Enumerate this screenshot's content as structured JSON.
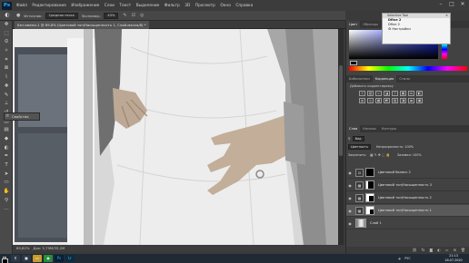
{
  "menu": {
    "items": [
      "Файл",
      "Редактирование",
      "Изображение",
      "Слои",
      "Текст",
      "Выделение",
      "Фильтр",
      "3D",
      "Просмотр",
      "Окно",
      "Справка"
    ]
  },
  "options": {
    "source_label": "Источник:",
    "sample_select": "Средняя точка",
    "exposure_label": "Экспонир.:",
    "exposure_value": "43%"
  },
  "document": {
    "tab_title": "Без имени-1 @ 89,8% (Цветовой тон/Насыщенность 1, Слой-маска/8) *",
    "zoom": "89,82%",
    "doc_info": "Док: 5,79М/35,2М"
  },
  "properties_float": {
    "label": "Свойства"
  },
  "panels": {
    "color_tabs": [
      "Цвет",
      "Образцы"
    ],
    "adj_tabs": [
      "Библиотеки",
      "Коррекция",
      "Стили"
    ],
    "adj_title": "Добавить корректировку",
    "layer_tabs": [
      "Слои",
      "Каналы",
      "Контуры"
    ],
    "filter_select": "Вид",
    "blend_select": "Цветность",
    "opacity_label": "Непрозрачность: 100%",
    "lock_label": "Закрепить:",
    "fill_label": "Заливка: 100%"
  },
  "layers": [
    {
      "name": "Цветовой баланс 2",
      "type": "balance"
    },
    {
      "name": "Цветовой тон/Насыщенность 3",
      "type": "hue"
    },
    {
      "name": "Цветовой тон/Насыщенность 2",
      "type": "hue"
    },
    {
      "name": "Цветовой тон/Насыщенность 1",
      "type": "hue",
      "selected": true
    },
    {
      "name": "Слой 1",
      "type": "photo"
    }
  ],
  "selective_tool": {
    "title": "Selective Tool",
    "row1": "Dfine 2",
    "row2": "Dfine 2",
    "row3": "⚙ Настройки"
  },
  "taskbar": {
    "time": "21:13",
    "date": "18.07.2020",
    "lang": "РУС"
  }
}
